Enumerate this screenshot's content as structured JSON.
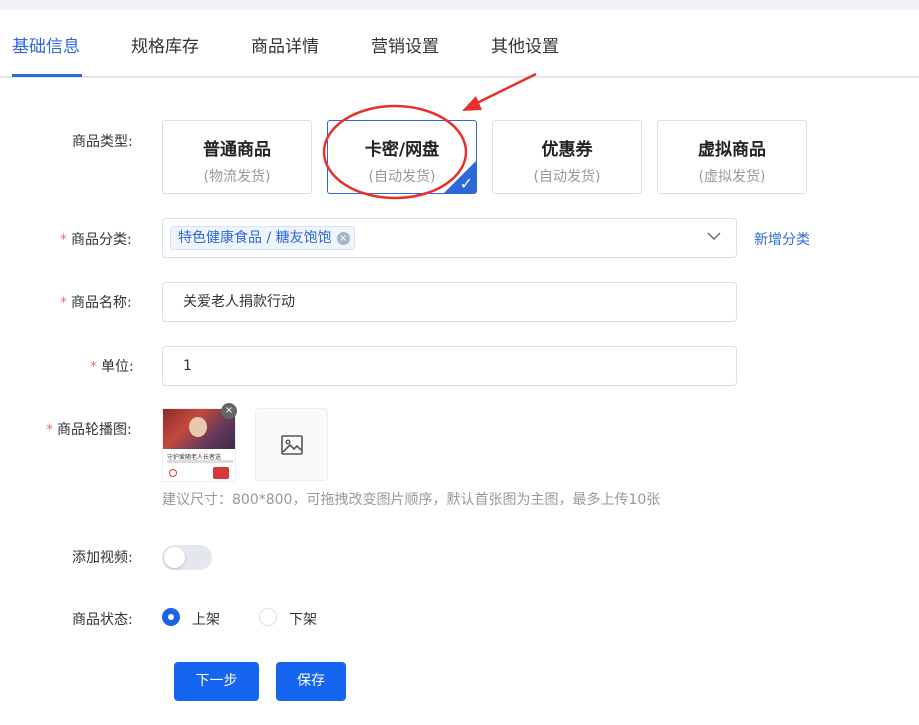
{
  "tabs": [
    {
      "label": "基础信息",
      "active": true
    },
    {
      "label": "规格库存",
      "active": false
    },
    {
      "label": "商品详情",
      "active": false
    },
    {
      "label": "营销设置",
      "active": false
    },
    {
      "label": "其他设置",
      "active": false
    }
  ],
  "product_type": {
    "label": "商品类型:",
    "options": [
      {
        "title": "普通商品",
        "sub": "(物流发货)",
        "selected": false
      },
      {
        "title": "卡密/网盘",
        "sub": "(自动发货)",
        "selected": true
      },
      {
        "title": "优惠券",
        "sub": "(自动发货)",
        "selected": false
      },
      {
        "title": "虚拟商品",
        "sub": "(虚拟发货)",
        "selected": false
      }
    ],
    "check_glyph": "✓"
  },
  "category": {
    "required_mark": "*",
    "label": "商品分类:",
    "tag": "特色健康食品 / 糖友饱饱",
    "tag_close": "×",
    "add_link": "新增分类"
  },
  "name": {
    "required_mark": "*",
    "label": "商品名称:",
    "value": "关爱老人捐款行动"
  },
  "unit": {
    "required_mark": "*",
    "label": "单位:",
    "value": "1"
  },
  "carousel": {
    "required_mark": "*",
    "label": "商品轮播图:",
    "thumb_caption": "守护爱随老人长者送",
    "remove_glyph": "×",
    "hint": "建议尺寸：800*800，可拖拽改变图片顺序，默认首张图为主图，最多上传10张"
  },
  "video": {
    "label": "添加视频:",
    "enabled": false
  },
  "status": {
    "label": "商品状态:",
    "options": [
      {
        "label": "上架",
        "checked": true
      },
      {
        "label": "下架",
        "checked": false
      }
    ]
  },
  "actions": {
    "next_label": "下一步",
    "save_label": "保存"
  },
  "colors": {
    "accent": "#2c68d8",
    "button": "#1565f0",
    "required": "#f56c6c",
    "annotation": "#e8302a"
  }
}
